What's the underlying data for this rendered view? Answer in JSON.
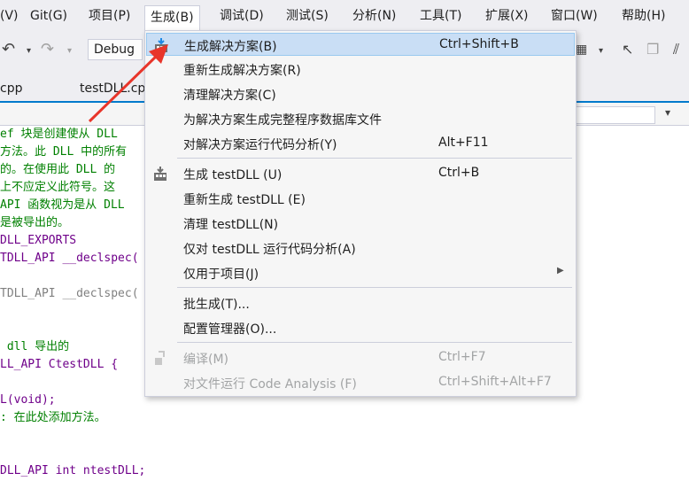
{
  "menubar": {
    "items": [
      {
        "label": "图(V)"
      },
      {
        "label": "Git(G)"
      },
      {
        "label": "项目(P)"
      },
      {
        "label": "生成(B)"
      },
      {
        "label": "调试(D)"
      },
      {
        "label": "测试(S)"
      },
      {
        "label": "分析(N)"
      },
      {
        "label": "工具(T)"
      },
      {
        "label": "扩展(X)"
      },
      {
        "label": "窗口(W)"
      },
      {
        "label": "帮助(H)"
      }
    ]
  },
  "toolbar": {
    "config_value": "Debug"
  },
  "tabs": [
    {
      "label": "cpp"
    },
    {
      "label": "testDLL.cp"
    }
  ],
  "editor": {
    "lines": [
      "ef 块是创建使从 DLL",
      "方法。此 DLL 中的所有",
      "的。在使用此 DLL 的",
      "上不应定义此符号。这",
      "API 函数视为是从 DLL",
      "是被导出的。",
      "DLL_EXPORTS",
      "TDLL_API __declspec(",
      "",
      "TDLL_API __declspec(",
      "",
      "",
      " dll 导出的",
      "LL_API CtestDLL {",
      "",
      "L(void);",
      ": 在此处添加方法。",
      "",
      "",
      "DLL_API int ntestDLL;"
    ]
  },
  "dropdown": {
    "items": [
      {
        "label": "生成解决方案(B)",
        "shortcut": "Ctrl+Shift+B",
        "icon": "build-icon"
      },
      {
        "label": "重新生成解决方案(R)",
        "shortcut": ""
      },
      {
        "label": "清理解决方案(C)",
        "shortcut": ""
      },
      {
        "label": "为解决方案生成完整程序数据库文件",
        "shortcut": ""
      },
      {
        "label": "对解决方案运行代码分析(Y)",
        "shortcut": "Alt+F11"
      },
      {
        "label": "生成 testDLL (U)",
        "shortcut": "Ctrl+B",
        "icon": "build-icon"
      },
      {
        "label": "重新生成 testDLL (E)",
        "shortcut": ""
      },
      {
        "label": "清理 testDLL(N)",
        "shortcut": ""
      },
      {
        "label": "仅对 testDLL 运行代码分析(A)",
        "shortcut": ""
      },
      {
        "label": "仅用于项目(J)",
        "shortcut": "",
        "submenu": true
      },
      {
        "label": "批生成(T)...",
        "shortcut": ""
      },
      {
        "label": "配置管理器(O)...",
        "shortcut": ""
      },
      {
        "label": "编译(M)",
        "shortcut": "Ctrl+F7",
        "disabled": true,
        "icon": "compile-icon"
      },
      {
        "label": "对文件运行 Code Analysis (F)",
        "shortcut": "Ctrl+Shift+Alt+F7",
        "disabled": true
      }
    ]
  },
  "annotation": {
    "arrow_color": "#e8352a"
  }
}
